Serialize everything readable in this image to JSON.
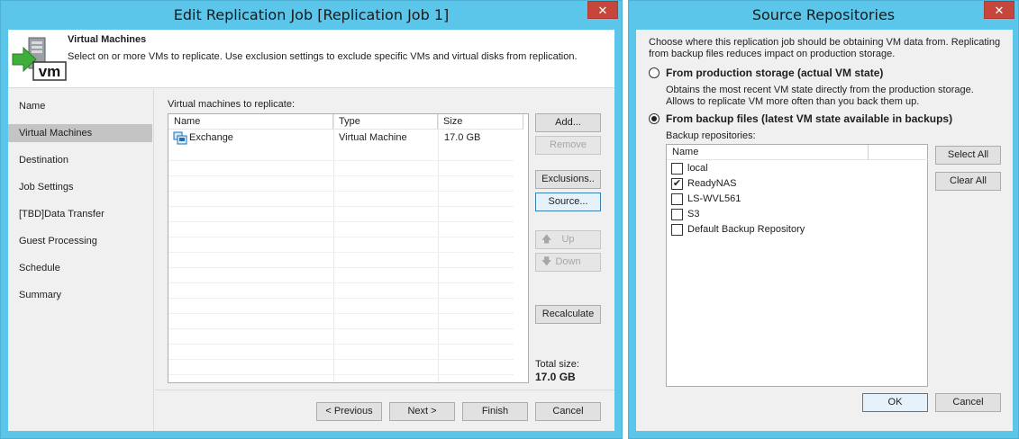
{
  "edit_window": {
    "title": "Edit Replication Job [Replication Job 1]",
    "close_glyph": "✕",
    "header": {
      "title": "Virtual Machines",
      "description": "Select on or more VMs to replicate. Use exclusion settings to exclude specific VMs and virtual disks from replication.",
      "icon_label": "vm"
    },
    "nav": [
      {
        "label": "Name"
      },
      {
        "label": "Virtual Machines"
      },
      {
        "label": "Destination"
      },
      {
        "label": "Job Settings"
      },
      {
        "label": "[TBD]Data Transfer"
      },
      {
        "label": "Guest Processing"
      },
      {
        "label": "Schedule"
      },
      {
        "label": "Summary"
      }
    ],
    "vms_label": "Virtual machines to replicate:",
    "columns": [
      "Name",
      "Type",
      "Size"
    ],
    "rows": [
      {
        "name": "Exchange",
        "type": "Virtual Machine",
        "size": "17.0 GB"
      }
    ],
    "buttons": {
      "add": "Add...",
      "remove": "Remove",
      "exclusions": "Exclusions..",
      "source": "Source...",
      "up": "Up",
      "down": "Down",
      "recalculate": "Recalculate"
    },
    "total_label": "Total size:",
    "total_value": "17.0 GB",
    "footer": {
      "previous": "< Previous",
      "next": "Next >",
      "finish": "Finish",
      "cancel": "Cancel"
    }
  },
  "source_window": {
    "title": "Source Repositories",
    "close_glyph": "✕",
    "intro": "Choose where this replication job should be obtaining VM data from. Replicating from backup files reduces impact on production storage.",
    "option_production": {
      "label": "From production storage (actual VM state)",
      "description": "Obtains the most recent VM state directly from the production storage. Allows to replicate VM more often than you back them up."
    },
    "option_backup": {
      "label": "From backup files (latest VM state available in backups)"
    },
    "repos_label": "Backup repositories:",
    "column": "Name",
    "repositories": [
      {
        "name": "local",
        "checked": false
      },
      {
        "name": "ReadyNAS",
        "checked": true
      },
      {
        "name": "LS-WVL561",
        "checked": false
      },
      {
        "name": "S3",
        "checked": false
      },
      {
        "name": "Default Backup Repository",
        "checked": false
      }
    ],
    "check_glyph": "✔",
    "buttons": {
      "select_all": "Select All",
      "clear_all": "Clear All",
      "ok": "OK",
      "cancel": "Cancel"
    }
  },
  "colors": {
    "titlebar": "#5bc6ea",
    "close": "#c7463c",
    "selected_nav": "#c4c4c4",
    "vm_arrow": "#3fae3a"
  }
}
